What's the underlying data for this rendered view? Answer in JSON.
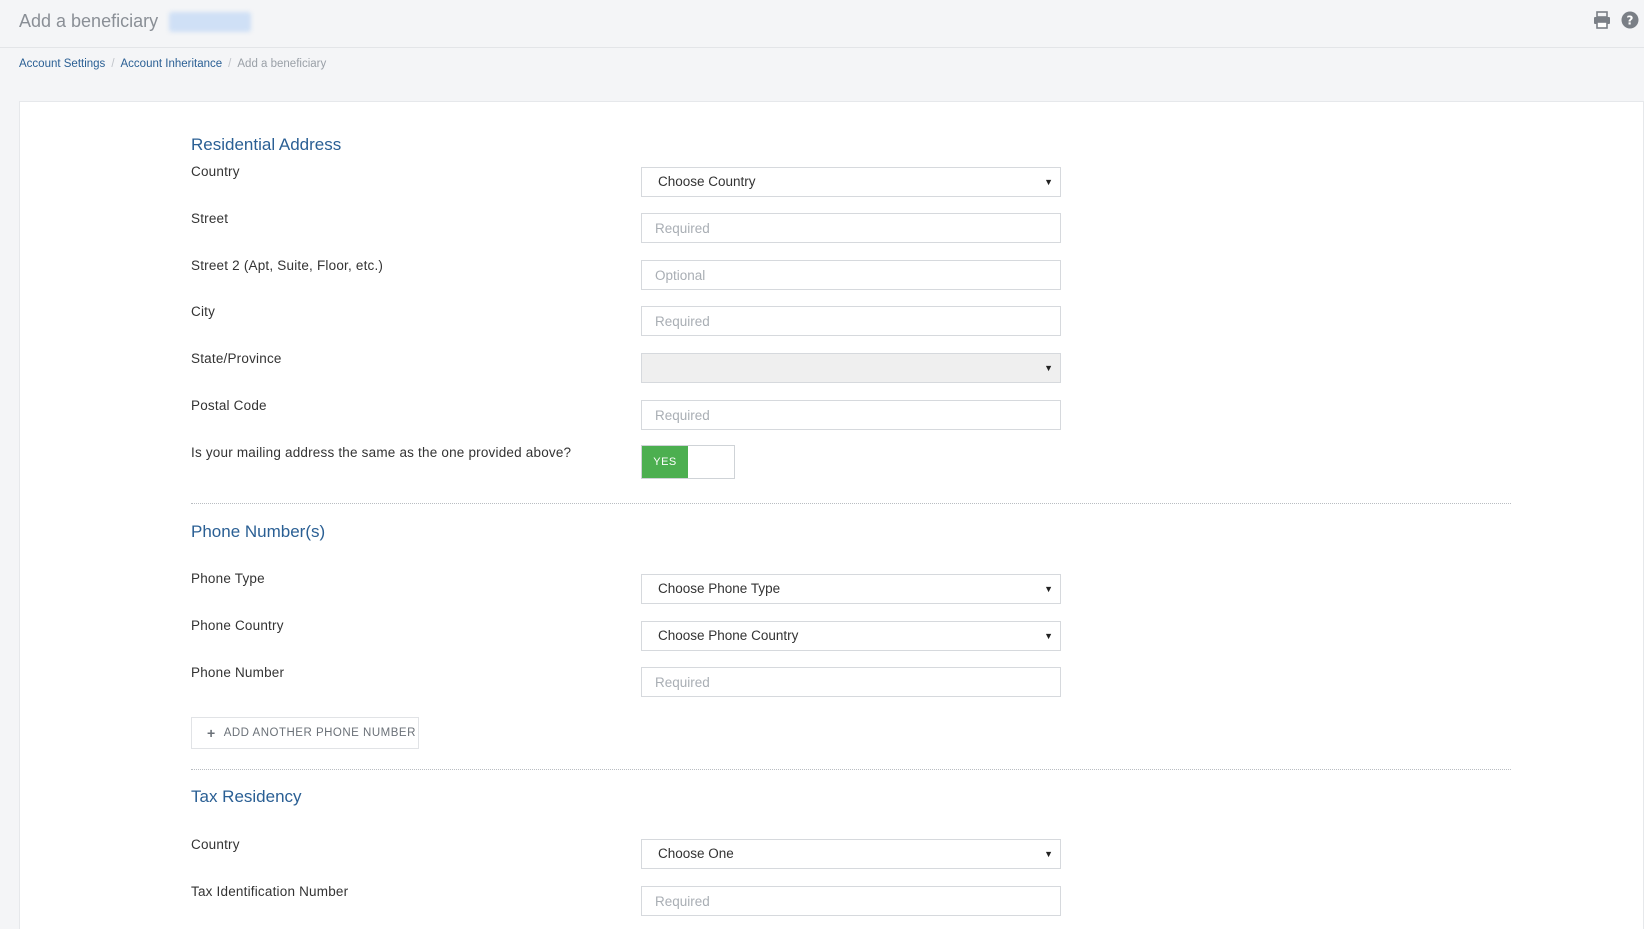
{
  "header": {
    "title": "Add a beneficiary",
    "print_icon": "printer-icon",
    "help_icon": "question-circle-icon"
  },
  "breadcrumb": {
    "items": [
      "Account Settings",
      "Account Inheritance"
    ],
    "current": "Add a beneficiary"
  },
  "residential": {
    "title": "Residential Address",
    "country_label": "Country",
    "country_value": "Choose Country",
    "street_label": "Street",
    "street_placeholder": "Required",
    "street2_label": "Street 2 (Apt, Suite, Floor, etc.)",
    "street2_placeholder": "Optional",
    "city_label": "City",
    "city_placeholder": "Required",
    "state_label": "State/Province",
    "state_value": "",
    "postal_label": "Postal Code",
    "postal_placeholder": "Required",
    "mailing_label": "Is your mailing address the same as the one provided above?",
    "mailing_toggle": "YES"
  },
  "phones": {
    "title": "Phone Number(s)",
    "type_label": "Phone Type",
    "type_value": "Choose Phone Type",
    "country_label": "Phone Country",
    "country_value": "Choose Phone Country",
    "number_label": "Phone Number",
    "number_placeholder": "Required",
    "add_button": "ADD ANOTHER PHONE NUMBER"
  },
  "tax": {
    "title": "Tax Residency",
    "country_label": "Country",
    "country_value": "Choose One",
    "tin_label": "Tax Identification Number",
    "tin_placeholder": "Required"
  },
  "colors": {
    "accent": "#2a5f94",
    "toggle_on": "#4caf50"
  }
}
